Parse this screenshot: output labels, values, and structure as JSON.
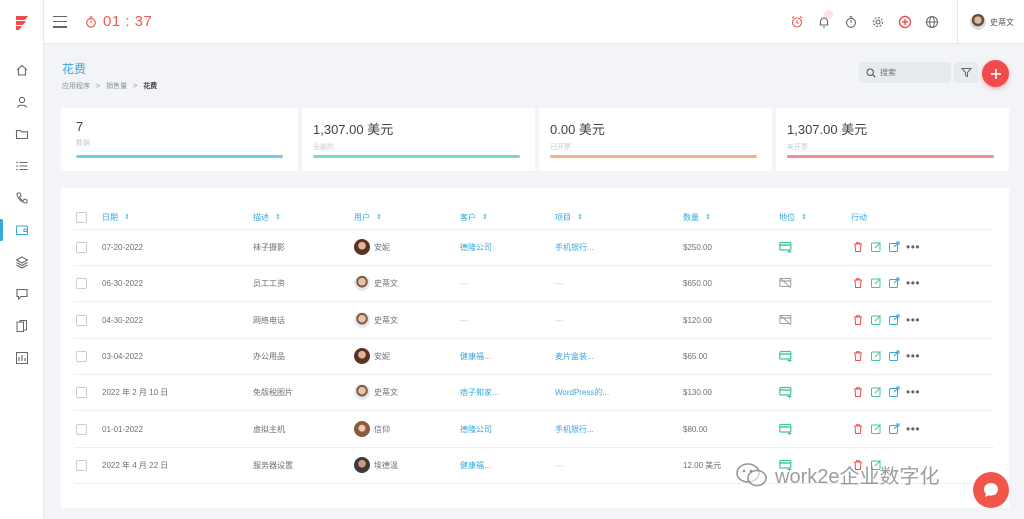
{
  "header": {
    "timer": "01 : 37",
    "user_name": "史蒂文"
  },
  "page": {
    "title": "花费",
    "breadcrumb": [
      "应用程序",
      "销售量",
      "花费"
    ]
  },
  "search": {
    "placeholder": "搜索"
  },
  "stats": [
    {
      "value": "7",
      "label": "数据",
      "color": "#6fcdeb"
    },
    {
      "value": "1,307.00 美元",
      "label": "全部的",
      "color": "#7ddac3"
    },
    {
      "value": "0.00 美元",
      "label": "已开票",
      "color": "#f5b27e"
    },
    {
      "value": "1,307.00 美元",
      "label": "未开票",
      "color": "#f58d95"
    }
  ],
  "table": {
    "columns": [
      "日期",
      "描述",
      "用户",
      "客户",
      "项目",
      "数量",
      "地位",
      "行动"
    ],
    "rows": [
      {
        "date": "07-20-2022",
        "desc": "袜子摄影",
        "user": "安妮",
        "client": "德隆公司",
        "project": "手机银行...",
        "amount": "$250.00",
        "status": "billable"
      },
      {
        "date": "06-30-2022",
        "desc": "员工工资",
        "user": "史蒂文",
        "client": "---",
        "project": "---",
        "amount": "$650.00",
        "status": "nonbillable"
      },
      {
        "date": "04-30-2022",
        "desc": "网络电话",
        "user": "史蒂文",
        "client": "---",
        "project": "---",
        "amount": "$120.00",
        "status": "nonbillable"
      },
      {
        "date": "03-04-2022",
        "desc": "办公用品",
        "user": "安妮",
        "client": "健康福...",
        "project": "麦片盒装...",
        "amount": "$65.00",
        "status": "billable"
      },
      {
        "date": "2022 年 2 月 10 日",
        "desc": "免版税图片",
        "user": "史蒂文",
        "client": "痞子和家...",
        "project": "WordPress的...",
        "amount": "$130.00",
        "status": "billable"
      },
      {
        "date": "01-01-2022",
        "desc": "虚拟主机",
        "user": "信仰",
        "client": "德隆公司",
        "project": "手机银行...",
        "amount": "$80.00",
        "status": "billable"
      },
      {
        "date": "2022 年 4 月 22 日",
        "desc": "服务器设置",
        "user": "埃德温",
        "client": "健康福...",
        "project": "---",
        "amount": "12.00 美元",
        "status": "billable"
      }
    ]
  },
  "watermark": "work2e企业数字化",
  "colors": {
    "accent": "#35a8dc",
    "danger": "#f14b4b",
    "timer": "#ee5a4f",
    "status_green": "#3cc89a"
  }
}
